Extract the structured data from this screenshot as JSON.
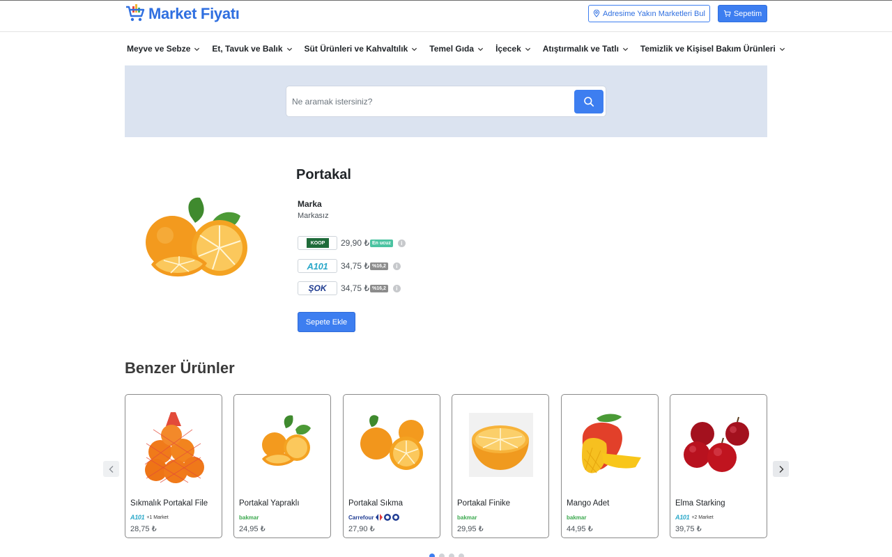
{
  "header": {
    "brand": "Market Fiyatı",
    "address_button": "Adresime Yakın Marketleri Bul",
    "cart_button": "Sepetim"
  },
  "nav": [
    {
      "label": "Meyve ve Sebze"
    },
    {
      "label": "Et, Tavuk ve Balık"
    },
    {
      "label": "Süt Ürünleri ve Kahvaltılık"
    },
    {
      "label": "Temel Gıda"
    },
    {
      "label": "İçecek"
    },
    {
      "label": "Atıştırmalık ve Tatlı"
    },
    {
      "label": "Temizlik ve Kişisel Bakım Ürünleri"
    }
  ],
  "search": {
    "placeholder": "Ne aramak istersiniz?"
  },
  "product": {
    "title": "Portakal",
    "brand_label": "Marka",
    "brand_value": "Markasız",
    "prices": [
      {
        "market": "KOOP",
        "price": "29,90 ₺",
        "badge": "En ucuz",
        "badge_color": "#4bc3a1"
      },
      {
        "market": "A101",
        "price": "34,75 ₺",
        "badge": "%16,2",
        "badge_color": "#8c8c8c"
      },
      {
        "market": "ŞOK",
        "price": "34,75 ₺",
        "badge": "%16,2",
        "badge_color": "#8c8c8c"
      }
    ],
    "add_button": "Sepete Ekle"
  },
  "similar": {
    "title": "Benzer Ürünler",
    "items": [
      {
        "name": "Sıkmalık Portakal File",
        "market": "A101",
        "extra": "+1 Market",
        "price": "28,75 ₺"
      },
      {
        "name": "Portakal Yapraklı",
        "market": "bakmar",
        "extra": "",
        "price": "24,95 ₺"
      },
      {
        "name": "Portakal Sıkma",
        "market": "Carrefour",
        "extra": "",
        "price": "27,90 ₺"
      },
      {
        "name": "Portakal Finike",
        "market": "bakmar",
        "extra": "",
        "price": "29,95 ₺"
      },
      {
        "name": "Mango Adet",
        "market": "bakmar",
        "extra": "",
        "price": "44,95 ₺"
      },
      {
        "name": "Elma Starking",
        "market": "A101",
        "extra": "+2 Market",
        "price": "39,75 ₺"
      }
    ]
  },
  "colors": {
    "accent": "#3d7ef0",
    "search_band": "#dbe3f0"
  }
}
